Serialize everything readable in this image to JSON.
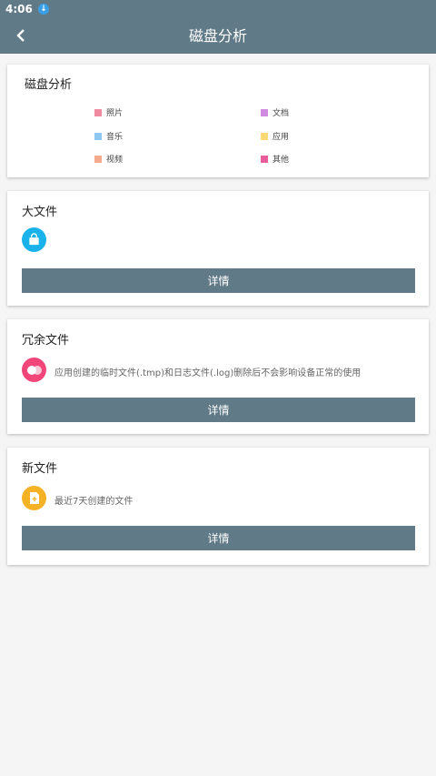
{
  "status_bar": {
    "time": "4:06",
    "notification_icon": "download-icon"
  },
  "app_bar": {
    "title": "磁盘分析",
    "back_icon": "chevron-left-icon"
  },
  "disk_card": {
    "title": "磁盘分析",
    "legend": [
      {
        "label": "照片",
        "color": "#f08aa0"
      },
      {
        "label": "文档",
        "color": "#cf8be0"
      },
      {
        "label": "音乐",
        "color": "#8ec8f2"
      },
      {
        "label": "应用",
        "color": "#fcd975"
      },
      {
        "label": "视频",
        "color": "#f5a98e"
      },
      {
        "label": "其他",
        "color": "#e85d9b"
      }
    ]
  },
  "large_files": {
    "title": "大文件",
    "icon": "shopping-bag-icon",
    "icon_color": "#1ab2ea",
    "button": "详情"
  },
  "redundant_files": {
    "title": "冗余文件",
    "icon": "overlap-circles-icon",
    "icon_color": "#f2457a",
    "description": "应用创建的临时文件(.tmp)和日志文件(.log)删除后不会影响设备正常的使用",
    "button": "详情"
  },
  "new_files": {
    "title": "新文件",
    "icon": "new-document-icon",
    "icon_color": "#f5b224",
    "description": "最近7天创建的文件",
    "button": "详情"
  }
}
